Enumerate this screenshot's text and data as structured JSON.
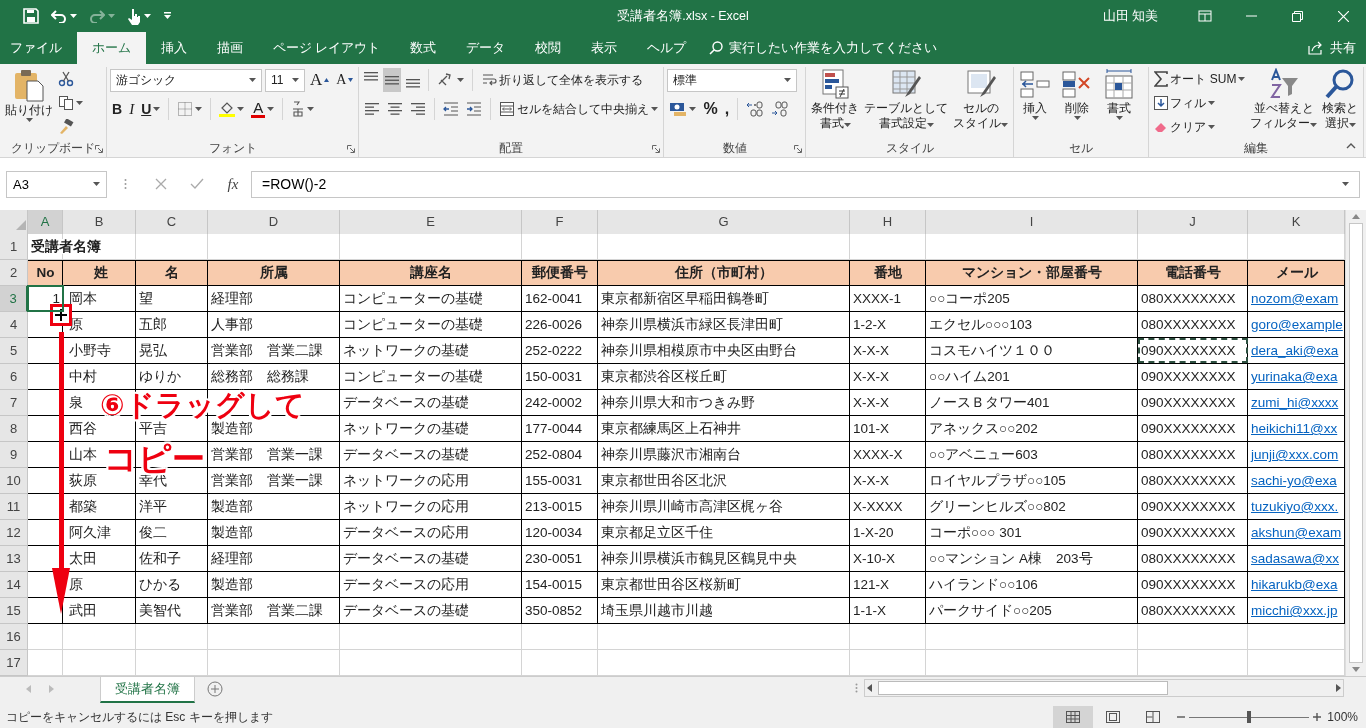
{
  "title_bar": {
    "title": "受講者名簿.xlsx  -  Excel",
    "user": "山田 知美"
  },
  "menu_tabs": [
    {
      "label": "ファイル",
      "selected": false
    },
    {
      "label": "ホーム",
      "selected": true
    },
    {
      "label": "挿入",
      "selected": false
    },
    {
      "label": "描画",
      "selected": false
    },
    {
      "label": "ページ レイアウト",
      "selected": false
    },
    {
      "label": "数式",
      "selected": false
    },
    {
      "label": "データ",
      "selected": false
    },
    {
      "label": "校閲",
      "selected": false
    },
    {
      "label": "表示",
      "selected": false
    },
    {
      "label": "ヘルプ",
      "selected": false
    }
  ],
  "tell_me": {
    "placeholder": "実行したい作業を入力してください"
  },
  "share": "共有",
  "ribbon": {
    "clipboard": {
      "paste": "貼り付け",
      "label": "クリップボード"
    },
    "font": {
      "font_name": "游ゴシック",
      "font_size": "11",
      "grow": "A",
      "shrink": "A",
      "bold": "B",
      "italic": "I",
      "underline": "U",
      "font_color": "A",
      "label": "フォント"
    },
    "alignment": {
      "wrap_text": "折り返して全体を表示する",
      "merge_center": "セルを結合して中央揃え",
      "label": "配置"
    },
    "number": {
      "format": "標準",
      "percent": "%",
      "comma": ",",
      "label": "数値"
    },
    "styles": {
      "buttons": [
        {
          "lines": [
            "条件付き",
            "書式"
          ]
        },
        {
          "lines": [
            "テーブルとして",
            "書式設定"
          ]
        },
        {
          "lines": [
            "セルの",
            "スタイル"
          ]
        }
      ],
      "label": "スタイル"
    },
    "cells": {
      "buttons": [
        "挿入",
        "削除",
        "書式"
      ],
      "label": "セル"
    },
    "editing": {
      "autosum": "オート SUM",
      "fill": "フィル",
      "clear": "クリア",
      "buttons": [
        {
          "lines": [
            "並べ替えと",
            "フィルター"
          ]
        },
        {
          "lines": [
            "検索と",
            "選択"
          ]
        }
      ],
      "label": "編集"
    }
  },
  "formula_bar": {
    "name_box": "A3",
    "fx": "fx",
    "formula": "=ROW()-2"
  },
  "sheet": {
    "columns": [
      "A",
      "B",
      "C",
      "D",
      "E",
      "F",
      "G",
      "H",
      "I",
      "J",
      "K"
    ],
    "rows": [
      {
        "number": "1",
        "kind": "title",
        "cells": [
          "受講者名簿"
        ]
      },
      {
        "number": "2",
        "kind": "header",
        "cells": [
          "No",
          "姓",
          "名",
          "所属",
          "講座名",
          "郵便番号",
          "住所（市町村）",
          "番地",
          "マンション・部屋番号",
          "電話番号",
          "メール"
        ]
      },
      {
        "number": "3",
        "kind": "data",
        "first_cell_selected": true,
        "phone_cell_copied": false,
        "cells": [
          "1",
          "岡本",
          "望",
          "経理部",
          "コンピューターの基礎",
          "162-0041",
          "東京都新宿区早稲田鶴巻町",
          "XXXX-1",
          "○○コーポ205",
          "080XXXXXXXX",
          "nozom@exam"
        ]
      },
      {
        "number": "4",
        "kind": "data",
        "first_cell_selected": false,
        "phone_cell_copied": false,
        "cells": [
          null,
          "原",
          "五郎",
          "人事部",
          "コンピューターの基礎",
          "226-0026",
          "神奈川県横浜市緑区長津田町",
          "1-2-X",
          "エクセル○○○103",
          "080XXXXXXXX",
          "goro@example"
        ]
      },
      {
        "number": "5",
        "kind": "data",
        "first_cell_selected": false,
        "phone_cell_copied": true,
        "cells": [
          null,
          "小野寺",
          "晃弘",
          "営業部　営業二課",
          "ネットワークの基礎",
          "252-0222",
          "神奈川県相模原市中央区由野台",
          "X-X-X",
          "コスモハイツ１００",
          "090XXXXXXXX",
          "dera_aki@exa"
        ]
      },
      {
        "number": "6",
        "kind": "data",
        "first_cell_selected": false,
        "phone_cell_copied": false,
        "cells": [
          null,
          "中村",
          "ゆりか",
          "総務部　総務課",
          "コンピューターの基礎",
          "150-0031",
          "東京都渋谷区桜丘町",
          "X-X-X",
          "○○ハイム201",
          "090XXXXXXXX",
          "yurinaka@exa"
        ]
      },
      {
        "number": "7",
        "kind": "data",
        "first_cell_selected": false,
        "phone_cell_copied": false,
        "cells": [
          null,
          "泉",
          null,
          null,
          "データベースの基礎",
          "242-0002",
          "神奈川県大和市つきみ野",
          "X-X-X",
          "ノースＢタワー401",
          "090XXXXXXXX",
          "zumi_hi@xxxx"
        ]
      },
      {
        "number": "8",
        "kind": "data",
        "first_cell_selected": false,
        "phone_cell_copied": false,
        "cells": [
          null,
          "西谷",
          "平吉",
          "製造部",
          "ネットワークの基礎",
          "177-0044",
          "東京都練馬区上石神井",
          "101-X",
          "アネックス○○202",
          "090XXXXXXXX",
          "heikichi11@xx"
        ]
      },
      {
        "number": "9",
        "kind": "data",
        "first_cell_selected": false,
        "phone_cell_copied": false,
        "cells": [
          null,
          "山本",
          null,
          "営業部　営業一課",
          "データベースの基礎",
          "252-0804",
          "神奈川県藤沢市湘南台",
          "XXXX-X",
          "○○アベニュー603",
          "080XXXXXXXX",
          "junji@xxx.com"
        ]
      },
      {
        "number": "10",
        "kind": "data",
        "first_cell_selected": false,
        "phone_cell_copied": false,
        "cells": [
          null,
          "荻原",
          "幸代",
          "営業部　営業一課",
          "ネットワークの応用",
          "155-0031",
          "東京都世田谷区北沢",
          "X-X-X",
          "ロイヤルプラザ○○105",
          "080XXXXXXXX",
          "sachi-yo@exa"
        ]
      },
      {
        "number": "11",
        "kind": "data",
        "first_cell_selected": false,
        "phone_cell_copied": false,
        "cells": [
          null,
          "都築",
          "洋平",
          "製造部",
          "ネットワークの応用",
          "213-0015",
          "神奈川県川崎市高津区梶ヶ谷",
          "X-XXXX",
          "グリーンヒルズ○○802",
          "090XXXXXXXX",
          "tuzukiyo@xxx."
        ]
      },
      {
        "number": "12",
        "kind": "data",
        "first_cell_selected": false,
        "phone_cell_copied": false,
        "cells": [
          null,
          "阿久津",
          "俊二",
          "製造部",
          "データベースの応用",
          "120-0034",
          "東京都足立区千住",
          "1-X-20",
          "コーポ○○○ 301",
          "090XXXXXXXX",
          "akshun@exam"
        ]
      },
      {
        "number": "13",
        "kind": "data",
        "first_cell_selected": false,
        "phone_cell_copied": false,
        "cells": [
          null,
          "太田",
          "佐和子",
          "経理部",
          "データベースの基礎",
          "230-0051",
          "神奈川県横浜市鶴見区鶴見中央",
          "X-10-X",
          "○○マンション A棟　203号",
          "080XXXXXXXX",
          "sadasawa@xx"
        ]
      },
      {
        "number": "14",
        "kind": "data",
        "first_cell_selected": false,
        "phone_cell_copied": false,
        "cells": [
          null,
          "原",
          "ひかる",
          "製造部",
          "データベースの応用",
          "154-0015",
          "東京都世田谷区桜新町",
          "121-X",
          "ハイランド○○106",
          "090XXXXXXXX",
          "hikarukb@exa"
        ]
      },
      {
        "number": "15",
        "kind": "data",
        "first_cell_selected": false,
        "phone_cell_copied": false,
        "cells": [
          null,
          "武田",
          "美智代",
          "営業部　営業二課",
          "データベースの基礎",
          "350-0852",
          "埼玉県川越市川越",
          "1-1-X",
          "パークサイド○○205",
          "080XXXXXXXX",
          "micchi@xxx.jp"
        ]
      },
      {
        "number": "16",
        "kind": "empty"
      },
      {
        "number": "17",
        "kind": "empty"
      }
    ]
  },
  "annotation": {
    "lines": [
      "⑥ドラッグして",
      "コピー"
    ]
  },
  "sheet_tabs": [
    {
      "label": "受講者名簿",
      "selected": true
    }
  ],
  "status_bar": {
    "message": "コピーをキャンセルするには Esc キーを押します",
    "zoom": "100%",
    "zoom_slider": {
      "level": 0.5
    }
  }
}
